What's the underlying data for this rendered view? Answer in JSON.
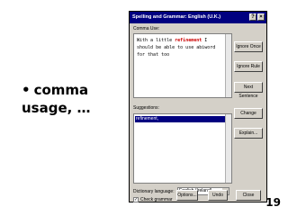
{
  "slide": {
    "bullet": "•",
    "bullet_text": "comma usage, …",
    "number": "19"
  },
  "dialog": {
    "title": "Spelling and Grammar: English (U.K.)",
    "help_icon": "question-icon",
    "close_icon": "close-icon",
    "section_label": "Comma Use:",
    "sentence_before": "With a little ",
    "sentence_highlight": "refinement",
    "sentence_after": " I should be able to use abiword for that too",
    "suggestions_label": "Suggestions:",
    "suggestions": [
      "refinement,"
    ],
    "dictionary_label": "Dictionary language:",
    "dictionary_value": "English (Ireland)",
    "check_grammar_label": "Check grammar",
    "check_grammar_checked": true,
    "buttons": {
      "ignore_once": "Ignore Once",
      "ignore_rule": "Ignore Rule",
      "next_sentence": "Next Sentence",
      "change": "Change",
      "explain": "Explain...",
      "options": "Options...",
      "undo": "Undo",
      "close": "Close"
    }
  }
}
